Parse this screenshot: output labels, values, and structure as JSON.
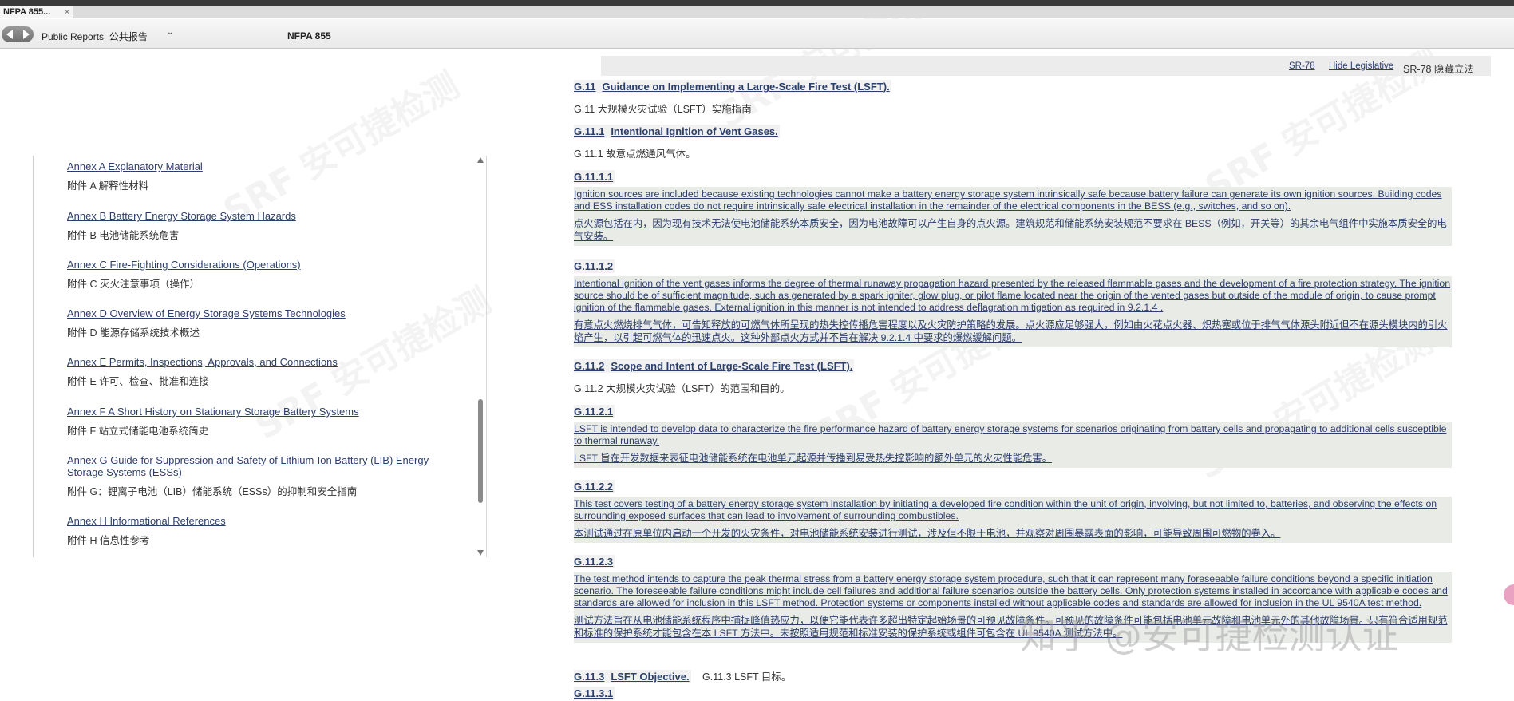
{
  "window": {
    "tab_title": "NFPA 855...",
    "tab_close": "×"
  },
  "toolbar": {
    "nav_back": "back",
    "nav_forward": "forward",
    "breadcrumb": "Public Reports  公共报告",
    "dropdown_icon": "chevron-down-icon",
    "dropdown_glyph": "⌄",
    "doc_title": "NFPA 855"
  },
  "toc": {
    "items": [
      {
        "en": "Annex A Explanatory Material",
        "cn": "附件 A 解释性材料"
      },
      {
        "en": "Annex B Battery Energy Storage System Hazards",
        "cn": "附件 B 电池储能系统危害"
      },
      {
        "en": "Annex C Fire-Fighting Considerations (Operations)",
        "cn": "附件 C 灭火注意事项（操作）"
      },
      {
        "en": "Annex D Overview of Energy Storage Systems Technologies",
        "cn": "附件 D 能源存储系统技术概述"
      },
      {
        "en": "Annex E Permits, Inspections, Approvals, and Connections",
        "cn": "附件 E 许可、检查、批准和连接"
      },
      {
        "en": "Annex F A Short History on Stationary Storage Battery Systems",
        "cn": "附件 F 站立式储能电池系统简史"
      },
      {
        "en": "Annex G Guide for Suppression and Safety of Lithium-Ion Battery (LIB) Energy Storage Systems (ESSs)",
        "cn": "附件 G：锂离子电池（LIB）储能系统（ESSs）的抑制和安全指南"
      },
      {
        "en": "Annex H Informational References",
        "cn": "附件 H 信息性参考"
      }
    ]
  },
  "sr_bar": {
    "sr_link": "SR-78",
    "hide_link": "Hide Legislative",
    "hide_text": "SR-78 隐藏立法"
  },
  "content": {
    "g11": {
      "num": "G.11",
      "title": "Guidance on Implementing a Large-Scale Fire Test (LSFT).",
      "cn": "G.11 大规模火灾试验（LSFT）实施指南"
    },
    "g111": {
      "num": "G.11.1",
      "title": "Intentional Ignition of Vent Gases.",
      "cn": "G.11.1 故意点燃通风气体。"
    },
    "g1111": {
      "num": "G.11.1.1",
      "en": "Ignition sources are included because existing technologies cannot make a battery energy storage system intrinsically safe because battery failure can generate its own ignition sources. Building codes and ESS installation codes do not require intrinsically safe electrical installation in the remainder of the electrical components in the BESS (e.g., switches, and so on).",
      "cn": "点火源包括在内，因为现有技术无法使电池储能系统本质安全，因为电池故障可以产生自身的点火源。建筑规范和储能系统安装规范不要求在 BESS（例如，开关等）的其余电气组件中实施本质安全的电气安装。"
    },
    "g1112": {
      "num": "G.11.1.2",
      "en": "Intentional ignition of the vent gases informs the degree of thermal runaway propagation hazard presented by the released flammable gases and the development of a fire protection strategy. The ignition source should be of sufficient magnitude, such as generated by a spark igniter, glow plug, or pilot flame located near the origin of the vented gases but outside of the module of origin, to cause prompt ignition of the flammable gases. External ignition in this manner is not intended to address deflagration mitigation as required in  9.2.1.4 .",
      "cn": "有意点火燃烧排气气体，可告知释放的可燃气体所呈现的热失控传播危害程度以及火灾防护策略的发展。点火源应足够强大，例如由火花点火器、炽热塞或位于排气气体源头附近但不在源头模块内的引火焰产生，以引起可燃气体的迅速点火。这种外部点火方式并不旨在解决 9.2.1.4 中要求的爆燃缓解问题。"
    },
    "g112": {
      "num": "G.11.2",
      "title": "Scope and Intent of Large-Scale Fire Test (LSFT).",
      "cn": "G.11.2 大规模火灾试验（LSFT）的范围和目的。"
    },
    "g1121": {
      "num": "G.11.2.1",
      "en": "LSFT is intended to develop data to characterize the fire performance hazard of battery energy storage systems for scenarios originating from battery cells and propagating to additional cells susceptible to thermal runaway.",
      "cn": "LSFT 旨在开发数据来表征电池储能系统在电池单元起源并传播到易受热失控影响的额外单元的火灾性能危害。"
    },
    "g1122": {
      "num": "G.11.2.2",
      "en": "This test covers testing of a battery energy storage system installation by initiating a developed fire condition within the unit of origin, involving, but not limited to, batteries, and observing the effects on surrounding exposed surfaces that can lead to involvement of surrounding combustibles.",
      "cn": "本测试通过在原单位内启动一个开发的火灾条件，对电池储能系统安装进行测试，涉及但不限于电池，并观察对周围暴露表面的影响，可能导致周围可燃物的卷入。"
    },
    "g1123": {
      "num": "G.11.2.3",
      "en": "The test method intends to capture the peak thermal stress from a battery energy storage system procedure, such that it can represent many foreseeable failure conditions beyond a specific initiation scenario. The foreseeable failure conditions might include cell failures and additional failure scenarios outside the battery cells. Only protection systems installed in accordance with applicable codes and standards are allowed for inclusion in this LSFT method. Protection systems or components installed without applicable codes and standards are allowed for inclusion in the UL 9540A test method.",
      "cn": "测试方法旨在从电池储能系统程序中捕捉峰值热应力，以便它能代表许多超出特定起始场景的可预见故障条件。可预见的故障条件可能包括电池单元故障和电池单元外的其他故障场景。只有符合适用规范和标准的保护系统才能包含在本 LSFT 方法中。未按照适用规范和标准安装的保护系统或组件可包含在 UL 9540A 测试方法中。"
    },
    "g113": {
      "num": "G.11.3",
      "title": "LSFT Objective.",
      "cn": "G.11.3 LSFT 目标。"
    },
    "g1131": {
      "num": "G.11.3.1"
    }
  },
  "watermarks": {
    "brand": "SRF 安可捷检测",
    "bottom": "知乎 @安可捷检测认证"
  }
}
